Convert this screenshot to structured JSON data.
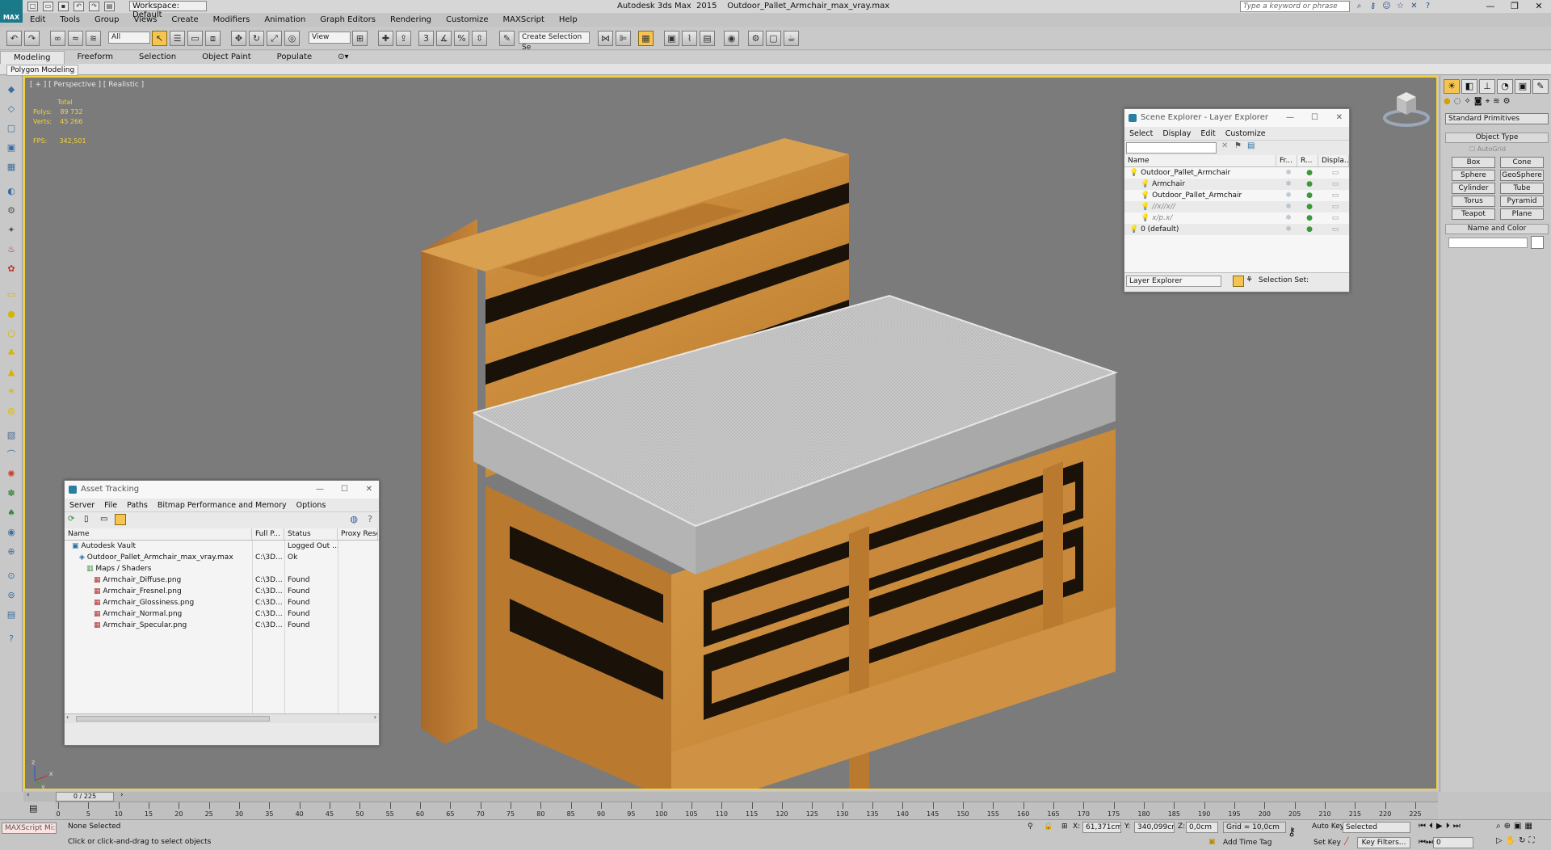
{
  "app": {
    "logo_text": "MAX",
    "title": "Autodesk 3ds Max  2015    Outdoor_Pallet_Armchair_max_vray.max",
    "workspace": "Workspace: Default",
    "search_placeholder": "Type a keyword or phrase"
  },
  "menu": [
    "Edit",
    "Tools",
    "Group",
    "Views",
    "Create",
    "Modifiers",
    "Animation",
    "Graph Editors",
    "Rendering",
    "Customize",
    "MAXScript",
    "Help"
  ],
  "toolbar": {
    "filter": "All",
    "refcoord": "View",
    "selection_set": "Create Selection Se"
  },
  "ribbon": {
    "tabs": [
      "Modeling",
      "Freeform",
      "Selection",
      "Object Paint",
      "Populate"
    ],
    "panel": "Polygon Modeling"
  },
  "viewport": {
    "label": "[ + ] [ Perspective ] [ Realistic ]",
    "stats_total": "Total",
    "polys_label": "Polys:",
    "polys": "89 732",
    "verts_label": "Verts:",
    "verts": "45 266",
    "fps_label": "FPS:",
    "fps": "342,501",
    "axis_x": "x",
    "axis_y": "y",
    "axis_z": "z"
  },
  "scene_explorer": {
    "title": "Scene Explorer - Layer Explorer",
    "menu": [
      "Select",
      "Display",
      "Edit",
      "Customize"
    ],
    "columns": [
      "Name",
      "Fr...",
      "R...",
      "Displa..."
    ],
    "rows": [
      {
        "name": "Outdoor_Pallet_Armchair",
        "indent": 0,
        "dim": false
      },
      {
        "name": "Armchair",
        "indent": 1,
        "dim": false
      },
      {
        "name": "Outdoor_Pallet_Armchair",
        "indent": 1,
        "dim": false
      },
      {
        "name": "//x//x//",
        "indent": 1,
        "dim": true
      },
      {
        "name": "x/p.x/",
        "indent": 1,
        "dim": true
      },
      {
        "name": "0 (default)",
        "indent": 0,
        "dim": false
      }
    ],
    "footer_mode": "Layer Explorer",
    "selection_set_label": "Selection Set:"
  },
  "asset_tracking": {
    "title": "Asset Tracking",
    "menu": [
      "Server",
      "File",
      "Paths",
      "Bitmap Performance and Memory",
      "Options"
    ],
    "columns": [
      "Name",
      "Full P...",
      "Status",
      "Proxy Reso"
    ],
    "rows": [
      {
        "name": "Autodesk Vault",
        "path": "",
        "status": "Logged Out ...",
        "indent": 1
      },
      {
        "name": "Outdoor_Pallet_Armchair_max_vray.max",
        "path": "C:\\3D...",
        "status": "Ok",
        "indent": 2
      },
      {
        "name": "Maps / Shaders",
        "path": "",
        "status": "",
        "indent": 3
      },
      {
        "name": "Armchair_Diffuse.png",
        "path": "C:\\3D...",
        "status": "Found",
        "indent": 4
      },
      {
        "name": "Armchair_Fresnel.png",
        "path": "C:\\3D...",
        "status": "Found",
        "indent": 4
      },
      {
        "name": "Armchair_Glossiness.png",
        "path": "C:\\3D...",
        "status": "Found",
        "indent": 4
      },
      {
        "name": "Armchair_Normal.png",
        "path": "C:\\3D...",
        "status": "Found",
        "indent": 4
      },
      {
        "name": "Armchair_Specular.png",
        "path": "C:\\3D...",
        "status": "Found",
        "indent": 4
      }
    ]
  },
  "command_panel": {
    "category": "Standard Primitives",
    "object_type_label": "Object Type",
    "autogrid": "AutoGrid",
    "buttons": [
      "Box",
      "Cone",
      "Sphere",
      "GeoSphere",
      "Cylinder",
      "Tube",
      "Torus",
      "Pyramid",
      "Teapot",
      "Plane"
    ],
    "name_color_label": "Name and Color"
  },
  "timeline": {
    "frame": "0 / 225",
    "ticks": [
      0,
      5,
      10,
      15,
      20,
      25,
      30,
      35,
      40,
      45,
      50,
      55,
      60,
      65,
      70,
      75,
      80,
      85,
      90,
      95,
      100,
      105,
      110,
      115,
      120,
      125,
      130,
      135,
      140,
      145,
      150,
      155,
      160,
      165,
      170,
      175,
      180,
      185,
      190,
      195,
      200,
      205,
      210,
      215,
      220,
      225
    ]
  },
  "status": {
    "maxscript": "MAXScript Mi:",
    "selection": "None Selected",
    "prompt": "Click or click-and-drag to select objects",
    "x_label": "X:",
    "x": "61,371cm",
    "y_label": "Y:",
    "y": "340,099cm",
    "z_label": "Z:",
    "z": "0,0cm",
    "grid": "Grid = 10,0cm",
    "add_time_tag": "Add Time Tag",
    "auto_key": "Auto Key",
    "set_key": "Set Key",
    "key_mode": "Selected",
    "key_filters": "Key Filters...",
    "frame_field": "0"
  }
}
